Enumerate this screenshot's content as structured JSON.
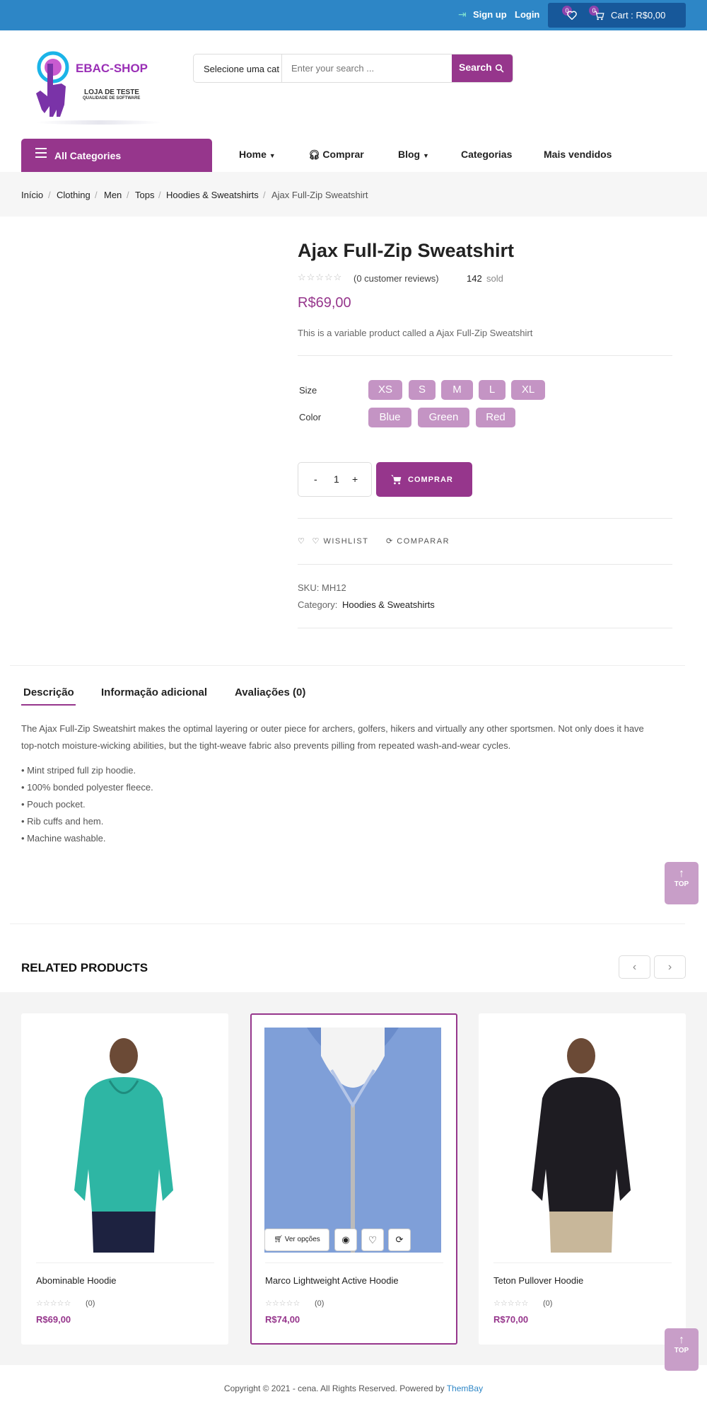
{
  "topbar": {
    "signup": "Sign up",
    "login": "Login",
    "wishlist_count": "0",
    "cart_count": "0",
    "cart_label": "Cart : R$0,00"
  },
  "logo": {
    "brand": "EBAC-SHOP",
    "line1": "LOJA DE TESTE",
    "line2": "QUALIDADE DE SOFTWARE"
  },
  "search": {
    "category": "Selecione uma cat",
    "placeholder": "Enter your search ...",
    "button": "Search"
  },
  "nav": {
    "all_categories": "All Categories",
    "items": [
      "Home",
      "Comprar",
      "Blog",
      "Categorias",
      "Mais vendidos"
    ]
  },
  "breadcrumb": [
    "Início",
    "Clothing",
    "Men",
    "Tops",
    "Hoodies & Sweatshirts",
    "Ajax Full-Zip Sweatshirt"
  ],
  "product": {
    "title": "Ajax Full-Zip Sweatshirt",
    "reviews": "(0 customer reviews)",
    "sold_count": "142",
    "sold_label": "sold",
    "price": "R$69,00",
    "short_desc": "This is a variable product called a Ajax Full-Zip Sweatshirt",
    "size_label": "Size",
    "sizes": [
      "XS",
      "S",
      "M",
      "L",
      "XL"
    ],
    "color_label": "Color",
    "colors": [
      "Blue",
      "Green",
      "Red"
    ],
    "qty_minus": "-",
    "qty_value": "1",
    "qty_plus": "+",
    "buy_button": "COMPRAR",
    "wishlist": "WISHLIST",
    "compare": "COMPARAR",
    "sku_label": "SKU:",
    "sku": "MH12",
    "category_label": "Category:",
    "category": "Hoodies & Sweatshirts"
  },
  "tabs": [
    "Descrição",
    "Informação adicional",
    "Avaliações (0)"
  ],
  "description": {
    "intro_line1": "The Ajax Full-Zip Sweatshirt makes the optimal layering or outer piece for archers, golfers, hikers and virtually any other sportsmen. Not only does it have",
    "intro_line2": "top-notch moisture-wicking abilities, but the tight-weave fabric also prevents pilling from repeated wash-and-wear cycles.",
    "bullets": [
      "• Mint striped full zip hoodie.",
      "• 100% bonded polyester fleece.",
      "• Pouch pocket.",
      "• Rib cuffs and hem.",
      "• Machine washable."
    ]
  },
  "back_to_top": "TOP",
  "related": {
    "title": "RELATED PRODUCTS",
    "products": [
      {
        "name": "Abominable Hoodie",
        "count": "(0)",
        "price": "R$69,00"
      },
      {
        "name": "Marco Lightweight Active Hoodie",
        "count": "(0)",
        "price": "R$74,00",
        "options": "Ver opções"
      },
      {
        "name": "Teton Pullover Hoodie",
        "count": "(0)",
        "price": "R$70,00"
      }
    ]
  },
  "footer": {
    "text": "Copyright © 2021 - cena. All Rights Reserved. Powered by",
    "link": "ThemBay"
  },
  "colors": {
    "accent": "#96368c",
    "topbar": "#2d86c6",
    "cart": "#17589a",
    "swatch": "#c494c4"
  }
}
